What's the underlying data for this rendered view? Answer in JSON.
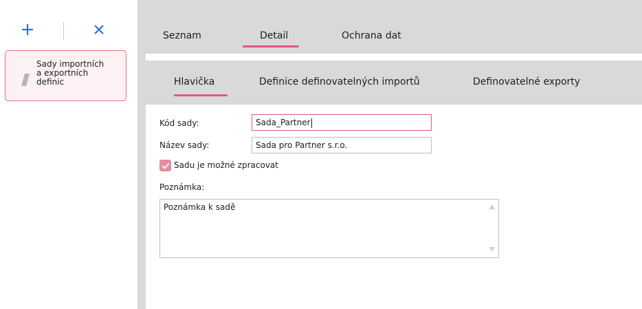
{
  "left_panel": {
    "add_icon": "plus-icon",
    "close_icon": "close-icon",
    "card": {
      "icon": "slash-icon",
      "label": "Sady importních\na exportních\ndefinic"
    }
  },
  "top_tabs": [
    {
      "label": "Seznam",
      "active": false
    },
    {
      "label": "Detail",
      "active": true
    },
    {
      "label": "Ochrana dat",
      "active": false
    }
  ],
  "sub_tabs": [
    {
      "label": "Hlavička",
      "active": true
    },
    {
      "label": "Definice definovatelných importů",
      "active": false
    },
    {
      "label": "Definovatelné exporty",
      "active": false
    }
  ],
  "form": {
    "kod_label": "Kód sady:",
    "kod_value": "Sada_Partner",
    "nazev_label": "Název sady:",
    "nazev_value": "Sada pro Partner s.r.o.",
    "checkbox_label": "Sadu je možné zpracovat",
    "checkbox_checked": true,
    "poznamka_label": "Poznámka:",
    "poznamka_value": "Poznámka k sadě"
  },
  "colors": {
    "accent": "#e3587a",
    "icon_blue": "#2f74d0",
    "panel_gray": "#d9d9d9",
    "card_bg": "#fdf1f4"
  }
}
